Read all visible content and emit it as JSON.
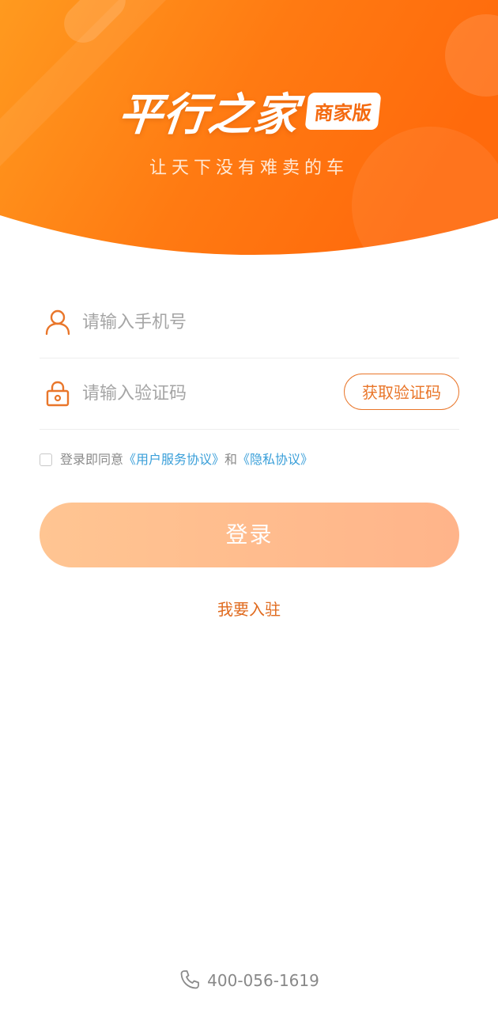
{
  "header": {
    "app_name": "平行之家",
    "edition_badge": "商家版",
    "slogan": "让天下没有难卖的车"
  },
  "form": {
    "phone": {
      "placeholder": "请输入手机号",
      "icon": "user-icon"
    },
    "code": {
      "placeholder": "请输入验证码",
      "icon": "lock-icon",
      "get_code_label": "获取验证码"
    }
  },
  "agreement": {
    "checked": false,
    "prefix": "登录即同意",
    "user_agreement": "《用户服务协议》",
    "conjunction": "和",
    "privacy_policy": "《隐私协议》"
  },
  "actions": {
    "login_label": "登录",
    "join_label": "我要入驻"
  },
  "footer": {
    "hotline": "400-056-1619",
    "icon": "phone-icon"
  },
  "colors": {
    "brand_orange": "#ff7a12",
    "accent": "#e9762a",
    "link": "#3a9fd9",
    "login_gradient_start": "#ffc592",
    "login_gradient_end": "#ffb48a"
  }
}
